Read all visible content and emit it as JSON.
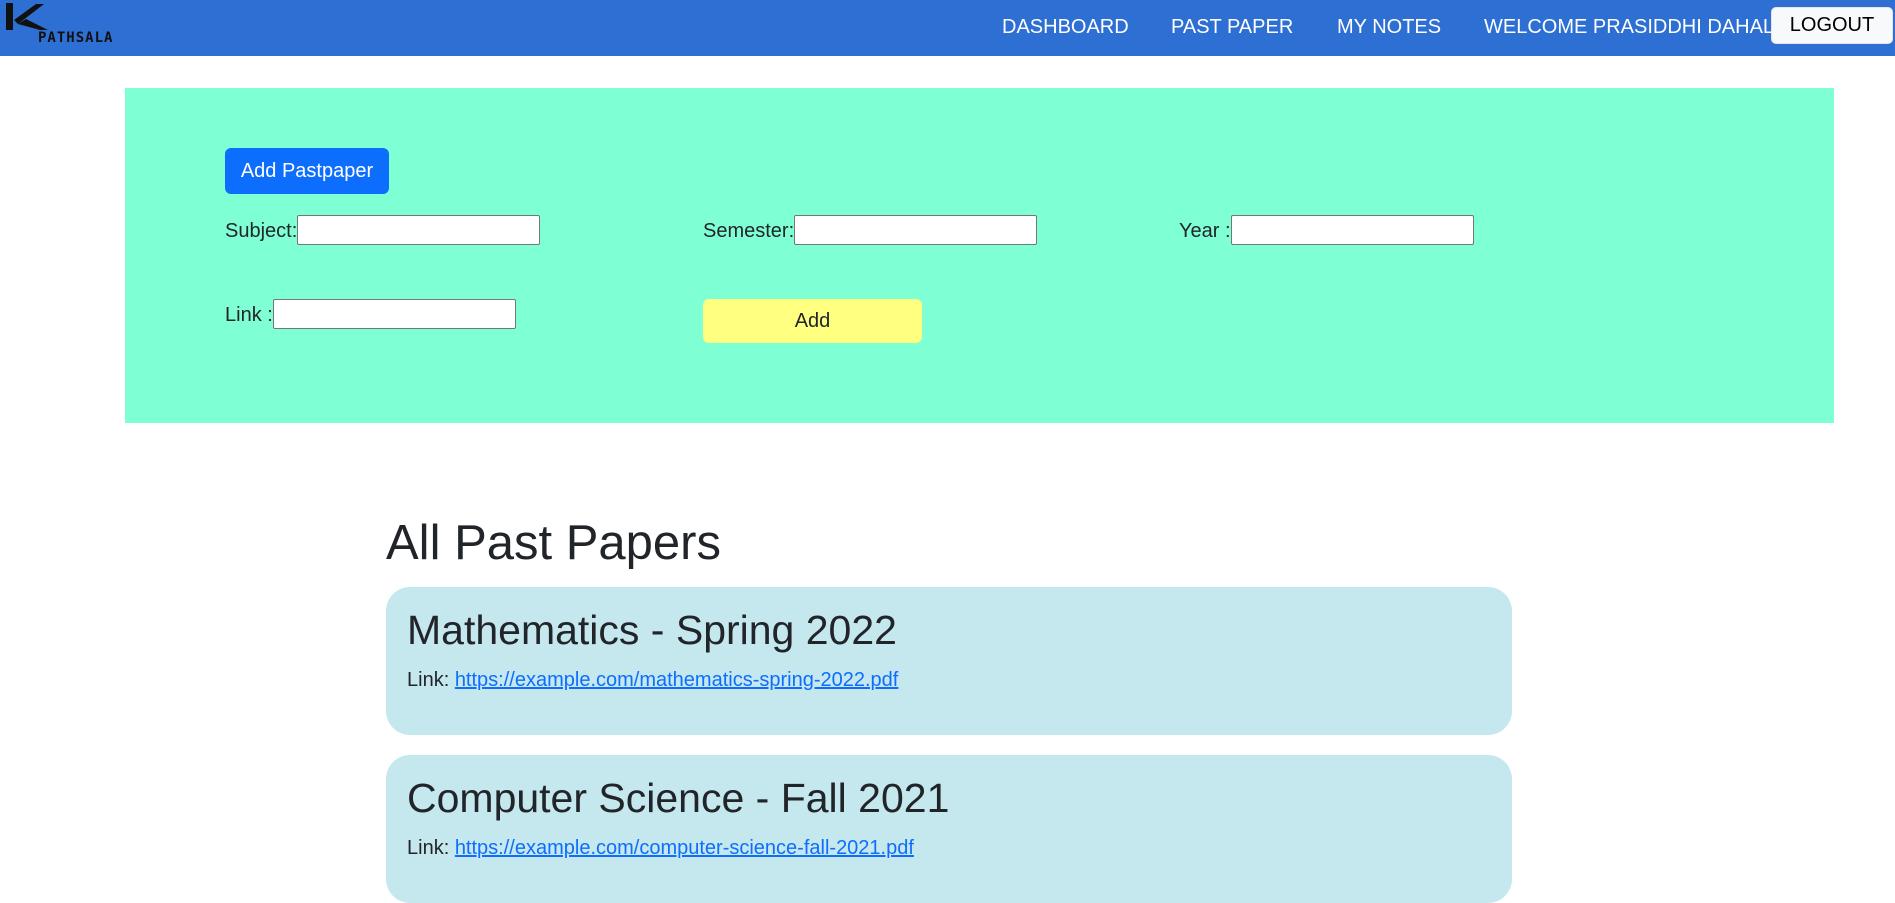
{
  "nav": {
    "logo_text": "PATHSALA",
    "items": [
      {
        "label": "DASHBOARD"
      },
      {
        "label": "PAST PAPER"
      },
      {
        "label": "MY NOTES"
      }
    ],
    "welcome": "WELCOME PRASIDDHI DAHAL",
    "logout_label": "LOGOUT"
  },
  "form": {
    "toggle_label": "Add Pastpaper",
    "subject_label": "Subject:",
    "subject_value": "",
    "semester_label": "Semester:",
    "semester_value": "",
    "year_label": "Year :",
    "year_value": "",
    "link_label": "Link :",
    "link_value": "",
    "submit_label": "Add"
  },
  "list": {
    "title": "All Past Papers",
    "papers": [
      {
        "title": "Mathematics - Spring 2022",
        "link_prefix": "Link:",
        "link": "https://example.com/mathematics-spring-2022.pdf"
      },
      {
        "title": "Computer Science - Fall 2021",
        "link_prefix": "Link:",
        "link": "https://example.com/computer-science-fall-2021.pdf"
      }
    ]
  },
  "colors": {
    "navbar": "#2d6fd2",
    "form_panel": "#7fffd4",
    "primary_button": "#0d6efd",
    "add_button": "#ffff80",
    "card": "#c5e7ee"
  }
}
